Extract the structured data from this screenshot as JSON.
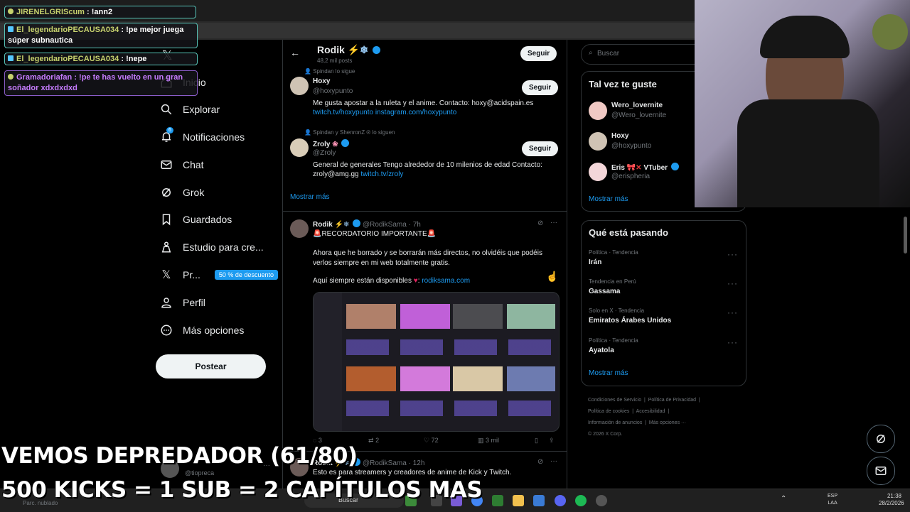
{
  "nav": {
    "home": "Inicio",
    "explore": "Explorar",
    "notifications": "Notificaciones",
    "notif_badge": "6",
    "chat": "Chat",
    "grok": "Grok",
    "saved": "Guardados",
    "studio": "Estudio para cre...",
    "premium": "Pr...",
    "premium_badge": "50 % de descuento",
    "profile": "Perfil",
    "more": "Más opciones",
    "post_button": "Postear",
    "account_handle": "@tiopreca"
  },
  "header": {
    "name": "Rodik",
    "posts_count": "48,2 mil posts",
    "follow": "Seguir"
  },
  "suggestions": [
    {
      "context": "Spindan lo sigue",
      "name": "Hoxy",
      "handle": "@hoxypunto",
      "bio": "Me gusta apostar a la ruleta y el anime. Contacto: hoxy@acidspain.es",
      "links": "twitch.tv/hoxypunto instagram.com/hoxypunto",
      "follow": "Seguir"
    },
    {
      "context": "Spindan y ShenronZ ® lo siguen",
      "name": "Zroly",
      "handle": "@Zroly",
      "bio": "General de generales Tengo alrededor de 10 milenios de edad Contacto: zroly@amg.gg",
      "links": "twitch.tv/zroly",
      "follow": "Seguir"
    }
  ],
  "show_more": "Mostrar más",
  "tweets": [
    {
      "name": "Rodik",
      "handle": "@RodikSama",
      "time": "· 7h",
      "line1": "RECORDATORIO IMPORTANTE",
      "para1": "Ahora que he borrado y se borrarán más directos, no olvidéis que podéis verlos siempre en mi web totalmente gratis.",
      "para2_prefix": "Aquí siempre están disponibles",
      "para2_link": "rodiksama.com",
      "replies": "3",
      "reposts": "2",
      "likes": "72",
      "views": "3 mil"
    },
    {
      "name": "Rodik",
      "handle": "@RodikSama",
      "time": "· 12h",
      "line1": "Esto es para streamers y creadores de anime de Kick y Twitch."
    }
  ],
  "right": {
    "search_placeholder": "Buscar",
    "suggest_title": "Tal vez te guste",
    "suggest": [
      {
        "name": "Wero_lovernite",
        "handle": "@Wero_lovernite"
      },
      {
        "name": "Hoxy",
        "handle": "@hoxypunto"
      },
      {
        "name": "Eris",
        "suffix": "VTuber",
        "handle": "@erispheria"
      }
    ],
    "suggest_more": "Mostrar más",
    "trends_title": "Qué está pasando",
    "trends": [
      {
        "category": "Política · Tendencia",
        "name": "Irán"
      },
      {
        "category": "Tendencia en Perú",
        "name": "Gassama"
      },
      {
        "category": "Solo en X · Tendencia",
        "name": "Emiratos Árabes Unidos"
      },
      {
        "category": "Política · Tendencia",
        "name": "Ayatola"
      }
    ],
    "trends_more": "Mostrar más",
    "footer": [
      "Condiciones de Servicio",
      "Política de Privacidad",
      "Política de cookies",
      "Accesibilidad",
      "Información de anuncios",
      "Más opciones ···",
      "© 2026 X Corp."
    ]
  },
  "chat": [
    {
      "user": "JIRENELGRIScum",
      "text": ": !ann2",
      "color": "#c7d26e"
    },
    {
      "user": "El_legendarioPECAUSA034",
      "text": ": !pe mejor juega súper subnautica",
      "color": "#c7d26e"
    },
    {
      "user": "El_legendarioPECAUSA034",
      "text": ": !nepe",
      "color": "#c7d26e"
    },
    {
      "user": "Gramadoriafan",
      "text": ": !pe te has vuelto en un gran soñador xdxdxdxd",
      "color": "#c77dff"
    }
  ],
  "overlay": {
    "line1": "VEMOS DEPREDADOR (61/80)",
    "line2": "500 KICKS = 1 SUB = 2 CAPÍTULOS MAS"
  },
  "taskbar": {
    "weather": "Parc. nublado",
    "search": "Buscar",
    "lang1": "ESP",
    "lang2": "LAA",
    "time": "21:38",
    "date": "28/2/2026"
  },
  "colors": {
    "accent": "#1d9bf0",
    "background": "#000000",
    "border": "#2f3336",
    "muted": "#71767b"
  }
}
